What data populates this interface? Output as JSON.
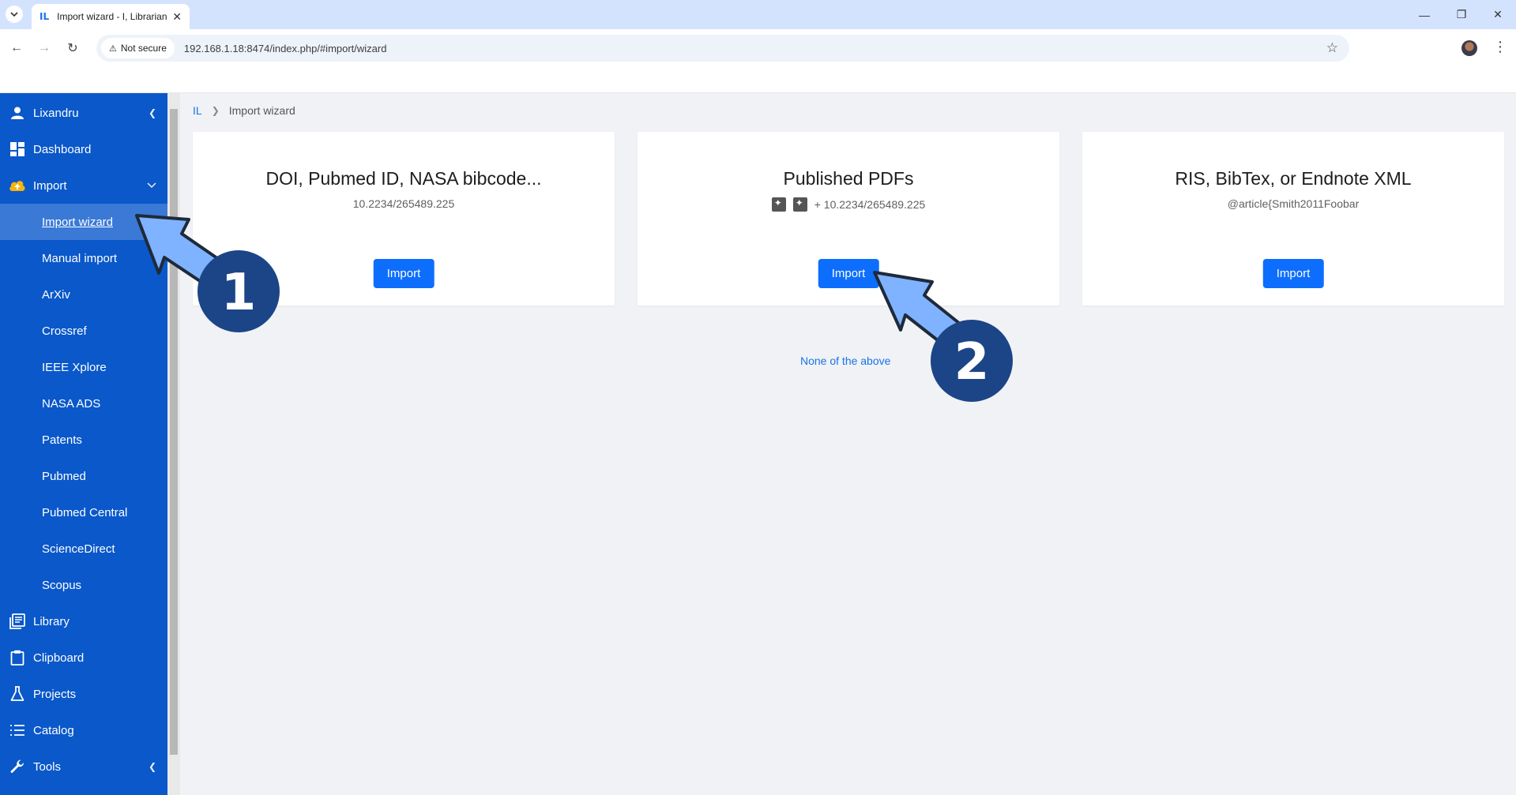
{
  "browser": {
    "tab_title": "Import wizard - I, Librarian",
    "tab_favicon": "IL",
    "security_label": "Not secure",
    "url": "192.168.1.18:8474/index.php/#import/wizard"
  },
  "sidebar": {
    "user": "Lixandru",
    "items": [
      {
        "label": "Dashboard",
        "icon": "dashboard-icon"
      },
      {
        "label": "Import",
        "icon": "cloud-upload-icon"
      },
      {
        "label": "Library",
        "icon": "library-icon"
      },
      {
        "label": "Clipboard",
        "icon": "clipboard-icon"
      },
      {
        "label": "Projects",
        "icon": "flask-icon"
      },
      {
        "label": "Catalog",
        "icon": "list-icon"
      },
      {
        "label": "Tools",
        "icon": "wrench-icon"
      }
    ],
    "import_subitems": [
      "Import wizard",
      "Manual import",
      "ArXiv",
      "Crossref",
      "IEEE Xplore",
      "NASA ADS",
      "Patents",
      "Pubmed",
      "Pubmed Central",
      "ScienceDirect",
      "Scopus"
    ],
    "accent_color": "#0a58ca"
  },
  "breadcrumb": {
    "home": "IL",
    "current": "Import wizard"
  },
  "cards": [
    {
      "title": "DOI, Pubmed ID, NASA bibcode...",
      "example": "10.2234/265489.225",
      "button": "Import"
    },
    {
      "title": "Published PDFs",
      "example": "+ 10.2234/265489.225",
      "button": "Import"
    },
    {
      "title": "RIS, BibTex, or Endnote XML",
      "example": "@article{Smith2011Foobar",
      "button": "Import"
    }
  ],
  "none_link": "None of the above",
  "annotations": {
    "step1": "1",
    "step2": "2",
    "arrow_color": "#7fb2ff",
    "badge_color": "#1c4587"
  }
}
